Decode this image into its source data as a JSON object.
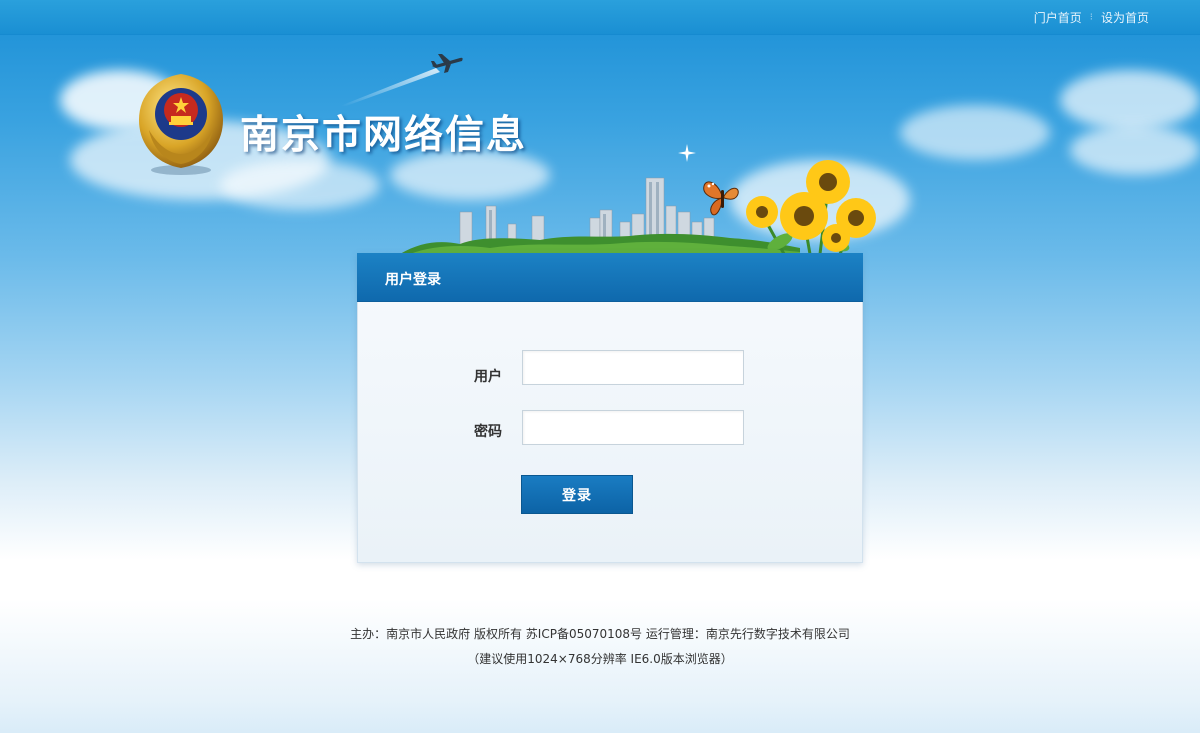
{
  "top_nav": {
    "home_link": "门户首页",
    "separator": "⁝",
    "set_home_link": "设为首页"
  },
  "header": {
    "site_title": "南京市网络信息"
  },
  "login": {
    "panel_title": "用户登录",
    "username_label": "用户",
    "username_value": "",
    "password_label": "密码",
    "password_value": "",
    "submit_label": "登录"
  },
  "footer": {
    "line1": "主办：南京市人民政府 版权所有 苏ICP备05070108号 运行管理：南京先行数字技术有限公司",
    "line2": "（建议使用1024×768分辨率 IE6.0版本浏览器）"
  },
  "colors": {
    "topbar": "#1a8fd3",
    "panel_header": "#1c82c5",
    "button": "#0c63a6",
    "sky": "#39a2e0"
  },
  "icons": {
    "emblem": "police-emblem-icon",
    "plane": "airplane-icon",
    "butterfly": "butterfly-icon",
    "sunflowers": "sunflower-icon",
    "sparkle": "sparkle-icon"
  }
}
